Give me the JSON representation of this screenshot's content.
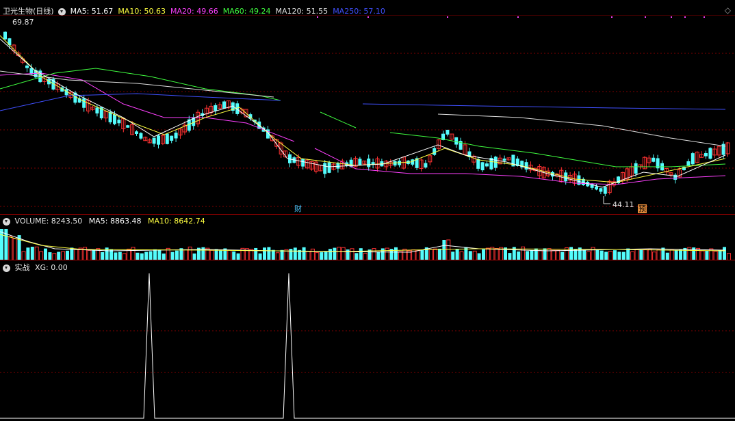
{
  "main_panel": {
    "stock_title": "卫光生物(日线)",
    "indicators": [
      {
        "label": "MA5: 51.67",
        "color": "#ffffff"
      },
      {
        "label": "MA10: 50.63",
        "color": "#ffff40"
      },
      {
        "label": "MA20: 49.66",
        "color": "#ff40ff"
      },
      {
        "label": "MA60: 49.24",
        "color": "#40ff40"
      },
      {
        "label": "MA120: 51.55",
        "color": "#e0e0e0"
      },
      {
        "label": "MA250: 57.10",
        "color": "#4050ff"
      }
    ],
    "high_label": "69.87",
    "low_label": "44.11",
    "marker_cai": "财",
    "marker_yu": "预"
  },
  "volume_panel": {
    "title": "VOLUME: 8243.50",
    "ma5": "MA5: 8863.48",
    "ma10": "MA10: 8642.74"
  },
  "signal_panel": {
    "title": "实战",
    "xg": "XG: 0.00"
  },
  "colors": {
    "up": "#ff3232",
    "down": "#54fcfc",
    "grid": "#800000",
    "separator": "#b00000"
  }
}
